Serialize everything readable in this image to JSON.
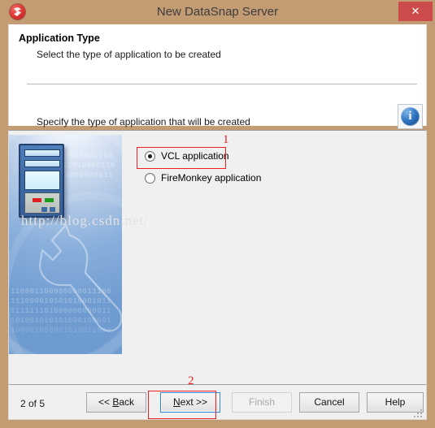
{
  "window": {
    "title": "New DataSnap Server",
    "app_icon": "embarcadero-flame-icon",
    "close_label": "✕",
    "frame_color": "#c49c74"
  },
  "header": {
    "title": "Application Type",
    "subtitle": "Select the type of application to be created",
    "description": "Specify the type of application that will be created",
    "info_icon": "info-icon"
  },
  "content": {
    "side_image": {
      "alt": "server-and-wrench-illustration",
      "binary_lines": [
        "00000001110",
        "101010000110",
        "00000000011",
        "110001100000000011100",
        "111000010101010001011",
        "111111101000000000011",
        "101001010101000100001",
        "100001000001010011000"
      ]
    },
    "options": [
      {
        "label": "VCL application",
        "checked": true
      },
      {
        "label": "FireMonkey application",
        "checked": false
      }
    ],
    "watermark": "http://blog.csdn.net/"
  },
  "footer": {
    "step": "2 of 5",
    "buttons": [
      {
        "id": "back",
        "text_pre": "<< ",
        "accel": "B",
        "text_post": "ack",
        "disabled": false,
        "focused": false
      },
      {
        "id": "next",
        "text_pre": "",
        "accel": "N",
        "text_post": "ext >>",
        "disabled": false,
        "focused": true
      },
      {
        "id": "finish",
        "text_pre": "",
        "accel": "",
        "text_post": "Finish",
        "disabled": true,
        "focused": false
      },
      {
        "id": "cancel",
        "text_pre": "",
        "accel": "",
        "text_post": "Cancel",
        "disabled": false,
        "focused": false
      },
      {
        "id": "help",
        "text_pre": "",
        "accel": "",
        "text_post": "Help",
        "disabled": false,
        "focused": false
      }
    ],
    "resize_grip": "resize-grip-icon"
  },
  "annotations": [
    {
      "number": "1",
      "targets": "vcl-application-radio"
    },
    {
      "number": "2",
      "targets": "next-button"
    }
  ],
  "colors": {
    "accent_red": "#ee2222",
    "focus_blue": "#2f86d8",
    "close_red": "#cc4c4c",
    "panel_gray": "#f0f0f0"
  }
}
